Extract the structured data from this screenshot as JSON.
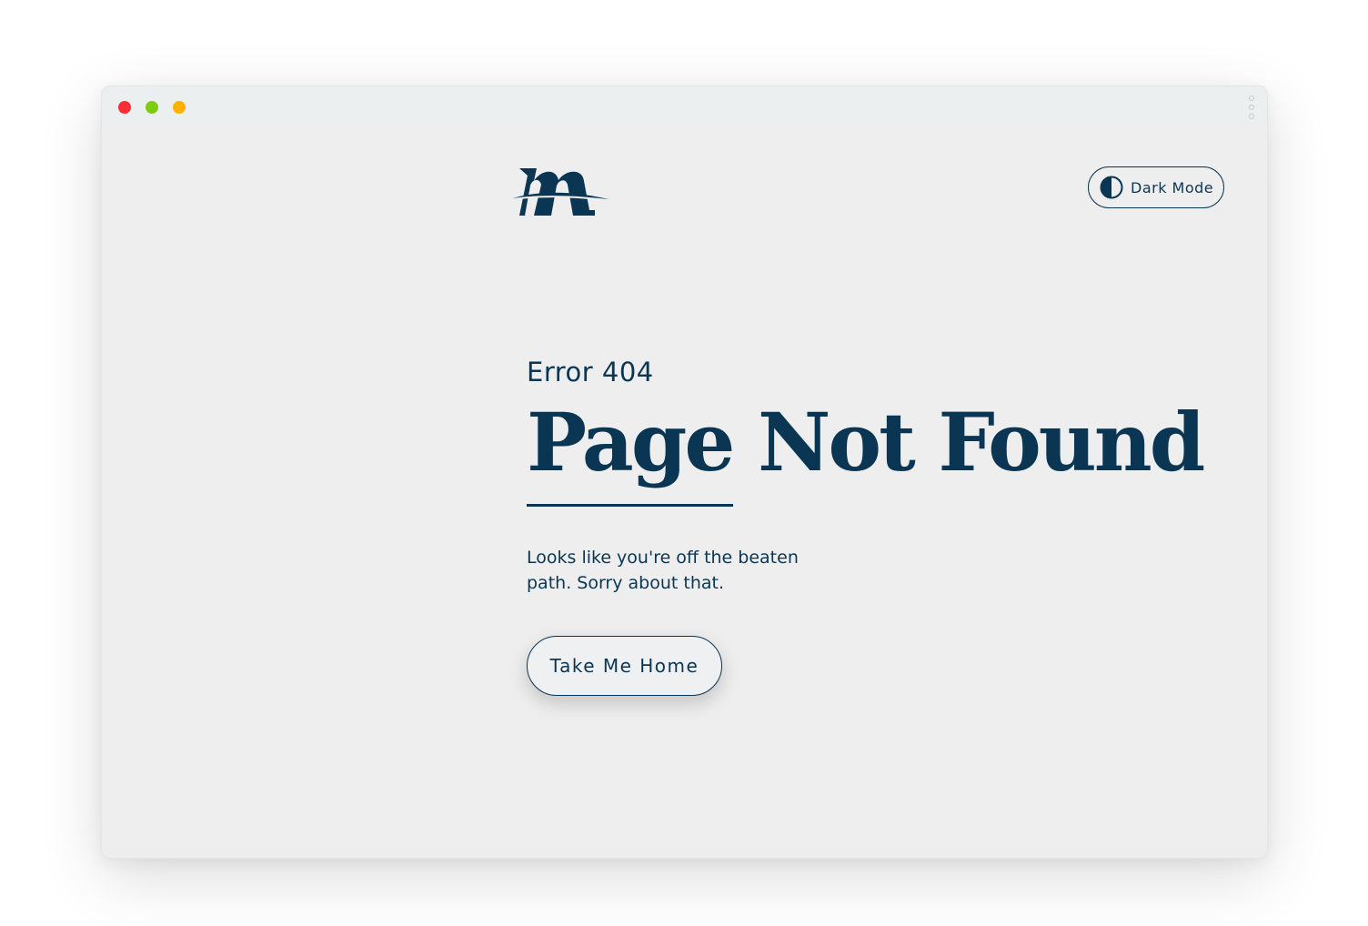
{
  "window": {
    "controls": [
      "close",
      "maximize",
      "minimize"
    ],
    "menu_icon": "vertical-ellipsis-icon"
  },
  "header": {
    "logo_icon": "m-logo-icon",
    "dark_mode_icon": "half-circle-contrast-icon",
    "dark_mode_label": "Dark Mode"
  },
  "main": {
    "error_code": "Error 404",
    "title": "Page Not Found",
    "description": "Looks like you're off the beaten path. Sorry about that.",
    "home_button_label": "Take Me Home"
  },
  "colors": {
    "brand": "#0a3653",
    "page_background": "#eeeeee",
    "titlebar_background": "#eceff0",
    "close_dot": "#ff2d34",
    "green_dot": "#7ecb12",
    "yellow_dot": "#ffb100"
  }
}
